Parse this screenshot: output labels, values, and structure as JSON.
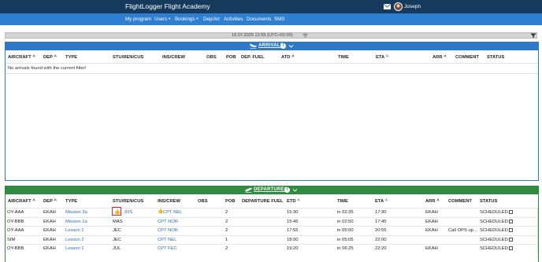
{
  "app": {
    "title": "FlightLogger Flight Academy",
    "user": "Joseph"
  },
  "nav": [
    "My program",
    "Users",
    "Bookings",
    "Dep/Arr",
    "Activities",
    "Documents",
    "SMS"
  ],
  "status": {
    "datetime": "16.07.2025 12:55  (UTC+02:00)"
  },
  "arrivals": {
    "title": "ARRIVALS",
    "headers": [
      "AIRCRAFT",
      "DEP",
      "TYPE",
      "STU/REN/CUS",
      "INS/CREW",
      "OBS",
      "POB",
      "DEP. FUEL",
      "ATD",
      "TIME",
      "ETA",
      "ARR",
      "COMMENT",
      "STATUS"
    ],
    "empty_message": "No arrivals found with the current filter!"
  },
  "departures": {
    "title": "DEPARTURES",
    "headers": [
      "AIRCRAFT",
      "DEP",
      "TYPE",
      "STU/REN/CUS",
      "INS/CREW",
      "OBS",
      "POB",
      "DEPARTURE FUEL",
      "ETD",
      "TIME",
      "ETA",
      "ARR",
      "COMMENT",
      "STATUS"
    ],
    "rows": [
      {
        "aircraft": "OY-AAA",
        "dep": "EKAH",
        "type": "Mission 3a",
        "stu": "JOS",
        "crew": "CPT NEL",
        "obs": "",
        "pob": "2",
        "fuel": "",
        "etd": "15:30",
        "time": "in 02:35",
        "eta": "17:30",
        "arr": "EKAH",
        "comment": "",
        "status": "SCHEDULED"
      },
      {
        "aircraft": "OY-BBB",
        "dep": "EKAH",
        "type": "Mission 1a",
        "stu": "MAS",
        "crew": "CPT NOR",
        "obs": "",
        "pob": "2",
        "fuel": "",
        "etd": "15:45",
        "time": "in 02:50",
        "eta": "17:45",
        "arr": "EKAH",
        "comment": "",
        "status": "SCHEDULED"
      },
      {
        "aircraft": "OY-AAA",
        "dep": "EKAH",
        "type": "Lesson 1",
        "stu": "JEC",
        "crew": "CPT NOR",
        "obs": "",
        "pob": "2",
        "fuel": "",
        "etd": "17:55",
        "time": "in 05:00",
        "eta": "20:55",
        "arr": "EKAH",
        "comment": "Call OPS up...",
        "status": "SCHEDULED"
      },
      {
        "aircraft": "SIM",
        "dep": "EKAH",
        "type": "Lesson 2",
        "stu": "JEC",
        "crew": "CPT NEL",
        "obs": "",
        "pob": "1",
        "fuel": "",
        "etd": "18:00",
        "time": "in 05:05",
        "eta": "22:00",
        "arr": "",
        "comment": "",
        "status": "SCHEDULED"
      },
      {
        "aircraft": "OY-BBB",
        "dep": "EKAH",
        "type": "Lesson 1",
        "stu": "JUL",
        "crew": "CPT FEC",
        "obs": "",
        "pob": "2",
        "fuel": "",
        "etd": "19:20",
        "time": "in 06:25",
        "eta": "22:20",
        "arr": "EKAH",
        "comment": "",
        "status": "SCHEDULED"
      }
    ]
  },
  "icons": [
    "mail-icon",
    "avatar",
    "wifi-icon",
    "filter-icon",
    "plane-landing-icon",
    "plane-takeoff-icon",
    "info-icon",
    "chevron-down-icon",
    "thumbs-up-icon",
    "calendar-icon"
  ],
  "colors": {
    "topbar": "#153a5c",
    "navbar": "#2f7fd0",
    "arrivals": "#2e79c6",
    "departures": "#2e8b40",
    "link": "#2a6db5",
    "highlight": "#e0261c"
  }
}
